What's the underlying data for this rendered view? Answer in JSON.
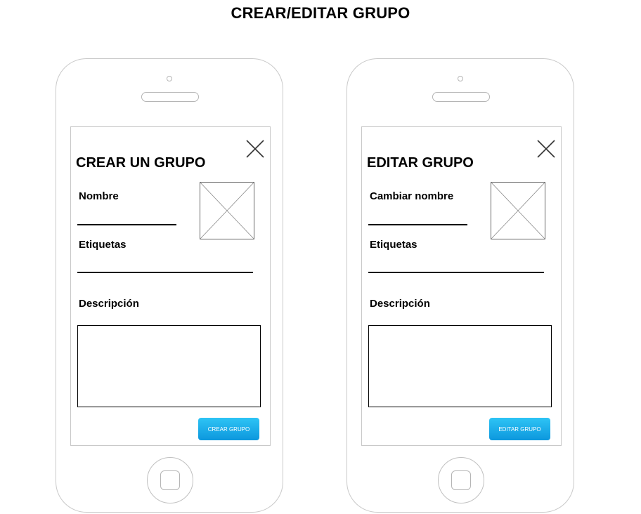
{
  "page": {
    "title": "CREAR/EDITAR GRUPO"
  },
  "screens": {
    "create": {
      "title": "CREAR UN GRUPO",
      "name_label": "Nombre",
      "tags_label": "Etiquetas",
      "description_label": "Descripción",
      "button_label": "CREAR GRUPO"
    },
    "edit": {
      "title": "EDITAR GRUPO",
      "name_label": "Cambiar nombre",
      "tags_label": "Etiquetas",
      "description_label": "Descripción",
      "button_label": "EDITAR GRUPO"
    }
  },
  "icons": {
    "close": "close-icon",
    "image": "image-placeholder-icon"
  },
  "colors": {
    "button_top": "#2ec4f5",
    "button_bottom": "#0c97dd",
    "frame": "#c9c9c9"
  }
}
